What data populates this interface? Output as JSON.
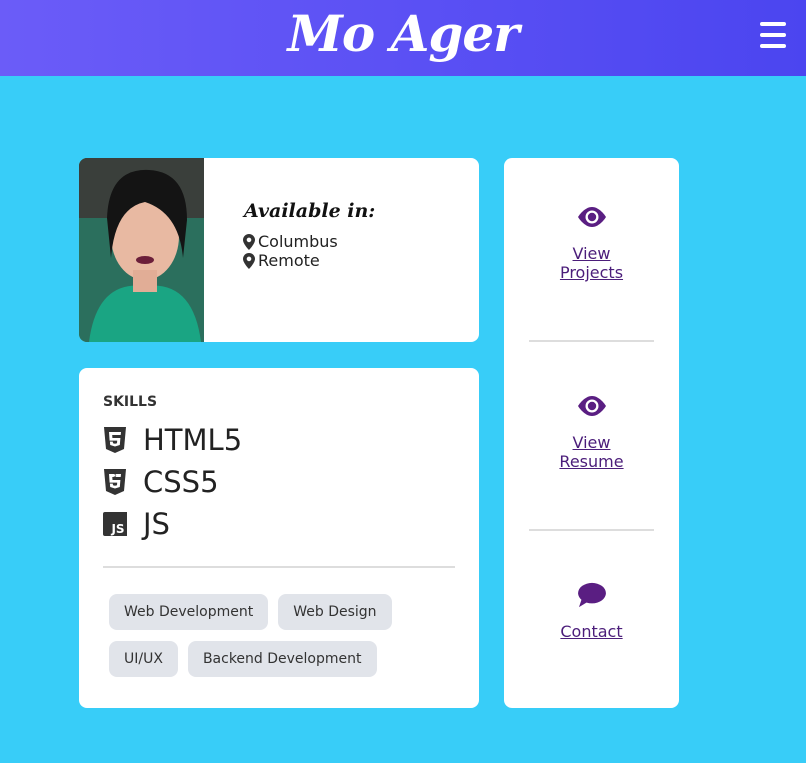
{
  "header": {
    "brand": "Mo Ager",
    "menu_icon": "hamburger-menu-icon",
    "background_color": "#5b52f4"
  },
  "profile": {
    "available_title": "Available in:",
    "locations": [
      "Columbus",
      "Remote"
    ]
  },
  "skills": {
    "heading": "SKILLS",
    "items": [
      {
        "label": "HTML5",
        "icon": "html5-icon"
      },
      {
        "label": "CSS5",
        "icon": "css3-icon"
      },
      {
        "label": "JS",
        "icon": "js-icon"
      }
    ],
    "tags": [
      "Web Development",
      "Web Design",
      "UI/UX",
      "Backend Development"
    ]
  },
  "links": [
    {
      "line1": "View",
      "line2": "Projects",
      "icon": "eye-icon"
    },
    {
      "line1": "View",
      "line2": "Resume",
      "icon": "eye-icon"
    },
    {
      "line1": "Contact",
      "line2": "",
      "icon": "chat-icon"
    }
  ],
  "colors": {
    "page_background": "#38cdf8",
    "link_color": "#4b1d7a",
    "tag_background": "#e1e4ea"
  }
}
